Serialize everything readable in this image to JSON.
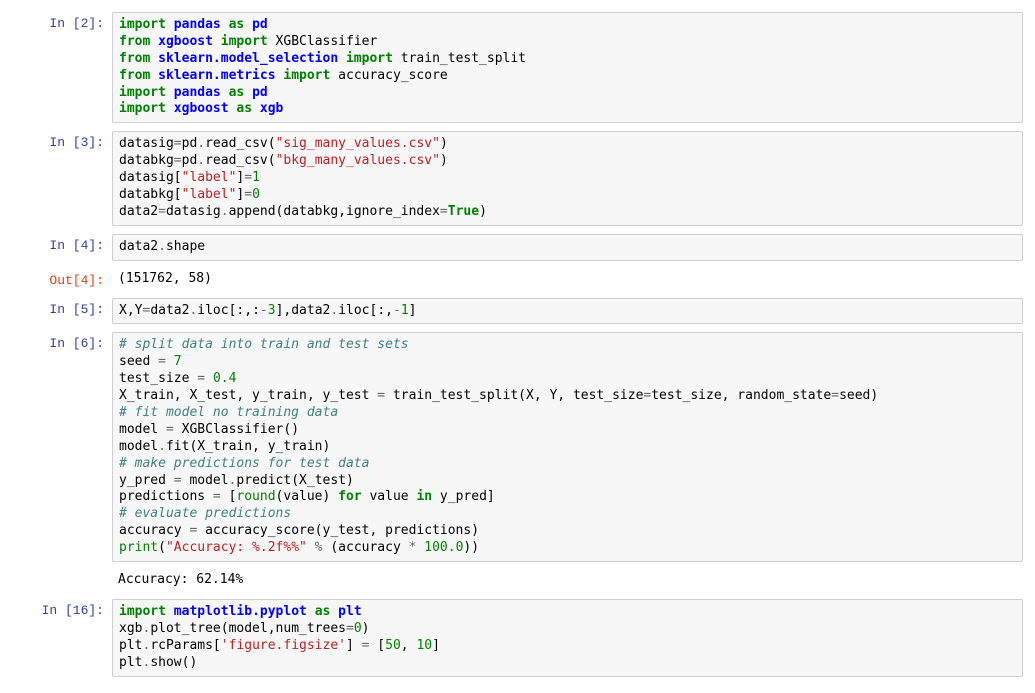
{
  "cells": [
    {
      "type": "in",
      "prompt": "In [2]:",
      "tokens": [
        {
          "t": "import ",
          "c": "kw"
        },
        {
          "t": "pandas",
          "c": "nn"
        },
        {
          "t": " "
        },
        {
          "t": "as",
          "c": "kw"
        },
        {
          "t": " "
        },
        {
          "t": "pd",
          "c": "nn"
        },
        {
          "t": "\n"
        },
        {
          "t": "from ",
          "c": "kw"
        },
        {
          "t": "xgboost",
          "c": "nn"
        },
        {
          "t": " "
        },
        {
          "t": "import",
          "c": "kw"
        },
        {
          "t": " XGBClassifier\n"
        },
        {
          "t": "from ",
          "c": "kw"
        },
        {
          "t": "sklearn.model_selection",
          "c": "nn"
        },
        {
          "t": " "
        },
        {
          "t": "import",
          "c": "kw"
        },
        {
          "t": " train_test_split\n"
        },
        {
          "t": "from ",
          "c": "kw"
        },
        {
          "t": "sklearn.metrics",
          "c": "nn"
        },
        {
          "t": " "
        },
        {
          "t": "import",
          "c": "kw"
        },
        {
          "t": " accuracy_score\n"
        },
        {
          "t": "import ",
          "c": "kw"
        },
        {
          "t": "pandas",
          "c": "nn"
        },
        {
          "t": " "
        },
        {
          "t": "as",
          "c": "kw"
        },
        {
          "t": " "
        },
        {
          "t": "pd",
          "c": "nn"
        },
        {
          "t": "\n"
        },
        {
          "t": "import ",
          "c": "kw"
        },
        {
          "t": "xgboost",
          "c": "nn"
        },
        {
          "t": " "
        },
        {
          "t": "as",
          "c": "kw"
        },
        {
          "t": " "
        },
        {
          "t": "xgb",
          "c": "nn"
        }
      ]
    },
    {
      "type": "in",
      "prompt": "In [3]:",
      "tokens": [
        {
          "t": "datasig"
        },
        {
          "t": "=",
          "c": "op"
        },
        {
          "t": "pd"
        },
        {
          "t": ".",
          "c": "op"
        },
        {
          "t": "read_csv("
        },
        {
          "t": "\"sig_many_values.csv\"",
          "c": "st"
        },
        {
          "t": ")\n"
        },
        {
          "t": "databkg"
        },
        {
          "t": "=",
          "c": "op"
        },
        {
          "t": "pd"
        },
        {
          "t": ".",
          "c": "op"
        },
        {
          "t": "read_csv("
        },
        {
          "t": "\"bkg_many_values.csv\"",
          "c": "st"
        },
        {
          "t": ")\n"
        },
        {
          "t": "datasig["
        },
        {
          "t": "\"label\"",
          "c": "st"
        },
        {
          "t": "]"
        },
        {
          "t": "=",
          "c": "op"
        },
        {
          "t": "1",
          "c": "nm"
        },
        {
          "t": "\n"
        },
        {
          "t": "databkg["
        },
        {
          "t": "\"label\"",
          "c": "st"
        },
        {
          "t": "]"
        },
        {
          "t": "=",
          "c": "op"
        },
        {
          "t": "0",
          "c": "nm"
        },
        {
          "t": "\n"
        },
        {
          "t": "data2"
        },
        {
          "t": "=",
          "c": "op"
        },
        {
          "t": "datasig"
        },
        {
          "t": ".",
          "c": "op"
        },
        {
          "t": "append(databkg,ignore_index"
        },
        {
          "t": "=",
          "c": "op"
        },
        {
          "t": "True",
          "c": "bool"
        },
        {
          "t": ")"
        }
      ]
    },
    {
      "type": "in",
      "prompt": "In [4]:",
      "tokens": [
        {
          "t": "data2"
        },
        {
          "t": ".",
          "c": "op"
        },
        {
          "t": "shape"
        }
      ]
    },
    {
      "type": "out",
      "prompt": "Out[4]:",
      "text": "(151762, 58)"
    },
    {
      "type": "in",
      "prompt": "In [5]:",
      "tokens": [
        {
          "t": "X,Y"
        },
        {
          "t": "=",
          "c": "op"
        },
        {
          "t": "data2"
        },
        {
          "t": ".",
          "c": "op"
        },
        {
          "t": "iloc[:,:"
        },
        {
          "t": "-",
          "c": "op"
        },
        {
          "t": "3",
          "c": "nm"
        },
        {
          "t": "],data2"
        },
        {
          "t": ".",
          "c": "op"
        },
        {
          "t": "iloc[:,"
        },
        {
          "t": "-",
          "c": "op"
        },
        {
          "t": "1",
          "c": "nm"
        },
        {
          "t": "]"
        }
      ]
    },
    {
      "type": "in",
      "prompt": "In [6]:",
      "tokens": [
        {
          "t": "# split data into train and test sets",
          "c": "cm"
        },
        {
          "t": "\n"
        },
        {
          "t": "seed "
        },
        {
          "t": "=",
          "c": "op"
        },
        {
          "t": " "
        },
        {
          "t": "7",
          "c": "nm"
        },
        {
          "t": "\n"
        },
        {
          "t": "test_size "
        },
        {
          "t": "=",
          "c": "op"
        },
        {
          "t": " "
        },
        {
          "t": "0.4",
          "c": "nm"
        },
        {
          "t": "\n"
        },
        {
          "t": "X_train, X_test, y_train, y_test "
        },
        {
          "t": "=",
          "c": "op"
        },
        {
          "t": " train_test_split(X, Y, test_size"
        },
        {
          "t": "=",
          "c": "op"
        },
        {
          "t": "test_size, random_state"
        },
        {
          "t": "=",
          "c": "op"
        },
        {
          "t": "seed)\n"
        },
        {
          "t": "# fit model no training data",
          "c": "cm"
        },
        {
          "t": "\n"
        },
        {
          "t": "model "
        },
        {
          "t": "=",
          "c": "op"
        },
        {
          "t": " XGBClassifier()\n"
        },
        {
          "t": "model"
        },
        {
          "t": ".",
          "c": "op"
        },
        {
          "t": "fit(X_train, y_train)\n"
        },
        {
          "t": "# make predictions for test data",
          "c": "cm"
        },
        {
          "t": "\n"
        },
        {
          "t": "y_pred "
        },
        {
          "t": "=",
          "c": "op"
        },
        {
          "t": " model"
        },
        {
          "t": ".",
          "c": "op"
        },
        {
          "t": "predict(X_test)\n"
        },
        {
          "t": "predictions "
        },
        {
          "t": "=",
          "c": "op"
        },
        {
          "t": " ["
        },
        {
          "t": "round",
          "c": "bi"
        },
        {
          "t": "(value) "
        },
        {
          "t": "for",
          "c": "kw"
        },
        {
          "t": " value "
        },
        {
          "t": "in",
          "c": "kw"
        },
        {
          "t": " y_pred]\n"
        },
        {
          "t": "# evaluate predictions",
          "c": "cm"
        },
        {
          "t": "\n"
        },
        {
          "t": "accuracy "
        },
        {
          "t": "=",
          "c": "op"
        },
        {
          "t": " accuracy_score(y_test, predictions)\n"
        },
        {
          "t": "print",
          "c": "bi"
        },
        {
          "t": "("
        },
        {
          "t": "\"Accuracy: %.2f%%\"",
          "c": "st"
        },
        {
          "t": " "
        },
        {
          "t": "%",
          "c": "op"
        },
        {
          "t": " (accuracy "
        },
        {
          "t": "*",
          "c": "op"
        },
        {
          "t": " "
        },
        {
          "t": "100.0",
          "c": "nm"
        },
        {
          "t": "))"
        }
      ]
    },
    {
      "type": "stdout",
      "prompt": "",
      "text": "Accuracy: 62.14%"
    },
    {
      "type": "in",
      "prompt": "In [16]:",
      "tokens": [
        {
          "t": "import ",
          "c": "kw"
        },
        {
          "t": "matplotlib.pyplot",
          "c": "nn"
        },
        {
          "t": " "
        },
        {
          "t": "as",
          "c": "kw"
        },
        {
          "t": " "
        },
        {
          "t": "plt",
          "c": "nn"
        },
        {
          "t": "\n"
        },
        {
          "t": "xgb"
        },
        {
          "t": ".",
          "c": "op"
        },
        {
          "t": "plot_tree(model,num_trees"
        },
        {
          "t": "=",
          "c": "op"
        },
        {
          "t": "0",
          "c": "nm"
        },
        {
          "t": ")\n"
        },
        {
          "t": "plt"
        },
        {
          "t": ".",
          "c": "op"
        },
        {
          "t": "rcParams["
        },
        {
          "t": "'figure.figsize'",
          "c": "st"
        },
        {
          "t": "] "
        },
        {
          "t": "=",
          "c": "op"
        },
        {
          "t": " ["
        },
        {
          "t": "50",
          "c": "nm"
        },
        {
          "t": ", "
        },
        {
          "t": "10",
          "c": "nm"
        },
        {
          "t": "]\n"
        },
        {
          "t": "plt"
        },
        {
          "t": ".",
          "c": "op"
        },
        {
          "t": "show()"
        }
      ]
    }
  ]
}
